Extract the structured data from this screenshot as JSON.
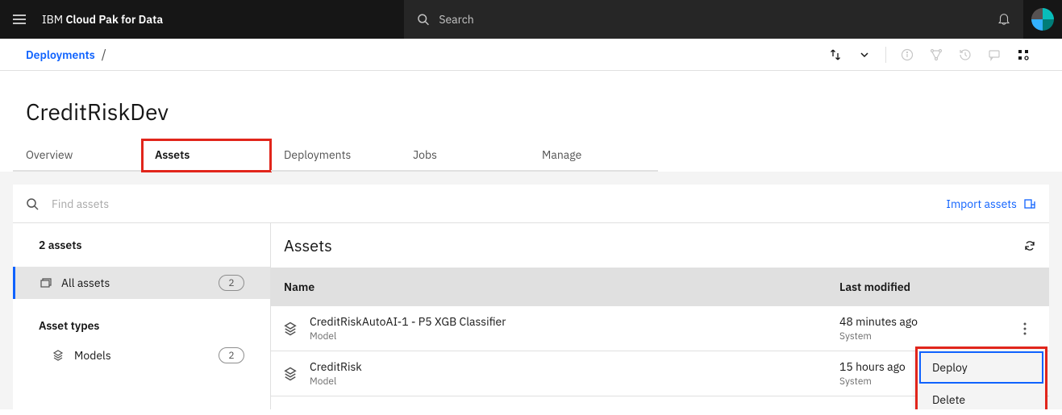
{
  "header": {
    "brand_prefix": "IBM",
    "brand_bold": "Cloud Pak for Data",
    "search_placeholder": "Search"
  },
  "breadcrumb": {
    "link": "Deployments",
    "sep": "/"
  },
  "page": {
    "title": "CreditRiskDev"
  },
  "tabs": {
    "overview": "Overview",
    "assets": "Assets",
    "deployments": "Deployments",
    "jobs": "Jobs",
    "manage": "Manage"
  },
  "panel": {
    "find_placeholder": "Find assets",
    "import_label": "Import assets"
  },
  "sidebar": {
    "summary": "2 assets",
    "all_label": "All assets",
    "all_count": "2",
    "types_label": "Asset types",
    "models_label": "Models",
    "models_count": "2"
  },
  "main": {
    "title": "Assets"
  },
  "table": {
    "head_name": "Name",
    "head_modified": "Last modified",
    "rows": [
      {
        "name": "CreditRiskAutoAI-1 - P5 XGB Classifier",
        "type": "Model",
        "modified": "48 minutes ago",
        "source": "System"
      },
      {
        "name": "CreditRisk",
        "type": "Model",
        "modified": "15 hours ago",
        "source": "System"
      }
    ]
  },
  "menu": {
    "deploy": "Deploy",
    "delete": "Delete"
  }
}
